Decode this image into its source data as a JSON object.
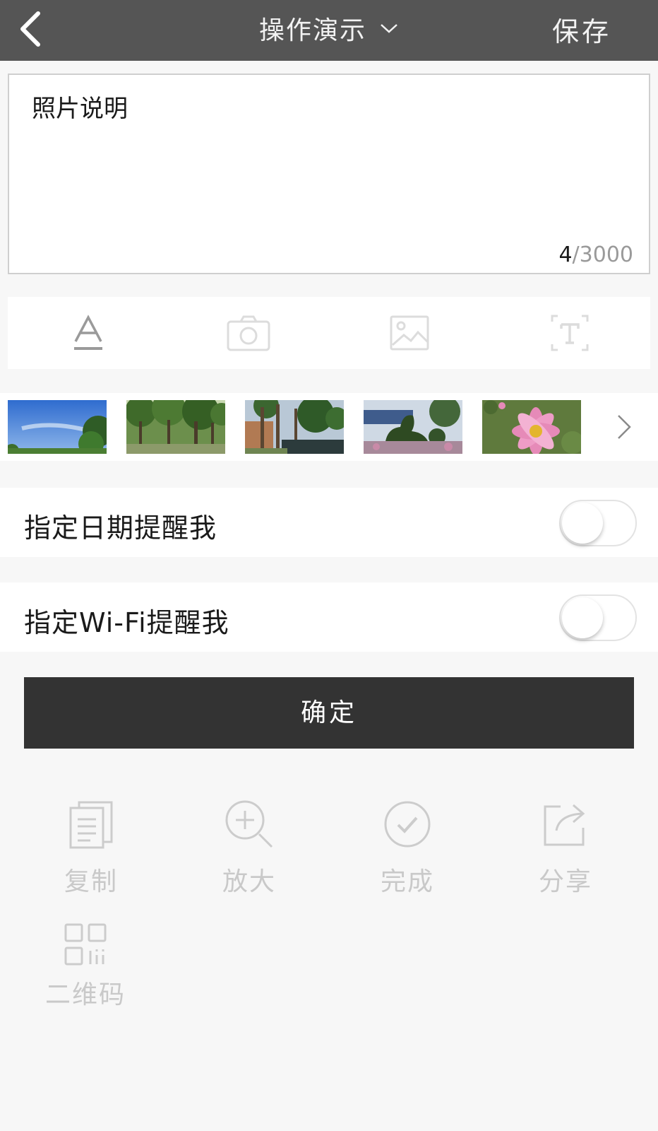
{
  "header": {
    "back_icon": "chevron-left-icon",
    "title": "操作演示",
    "title_dropdown_icon": "chevron-down-icon",
    "save_label": "保存"
  },
  "caption": {
    "text": "照片说明",
    "count_current": "4",
    "count_max": "/3000"
  },
  "toolbar": {
    "icons": [
      "text-format-icon",
      "camera-icon",
      "image-icon",
      "text-box-icon"
    ]
  },
  "thumbnails": {
    "items": [
      "sky-trees-photo",
      "tree-grove-photo",
      "palm-pond-photo",
      "topiary-garden-photo",
      "pink-flower-photo"
    ],
    "next_icon": "chevron-right-icon"
  },
  "settings": {
    "date_reminder_label": "指定日期提醒我",
    "date_reminder_on": false,
    "wifi_reminder_label": "指定Wi-Fi提醒我",
    "wifi_reminder_on": false
  },
  "confirm_label": "确定",
  "actions": {
    "copy": "复制",
    "zoom": "放大",
    "done": "完成",
    "share": "分享",
    "qrcode": "二维码"
  },
  "colors": {
    "header_bg": "#555555",
    "confirm_bg": "#333333",
    "muted_icon": "#cccccc"
  }
}
